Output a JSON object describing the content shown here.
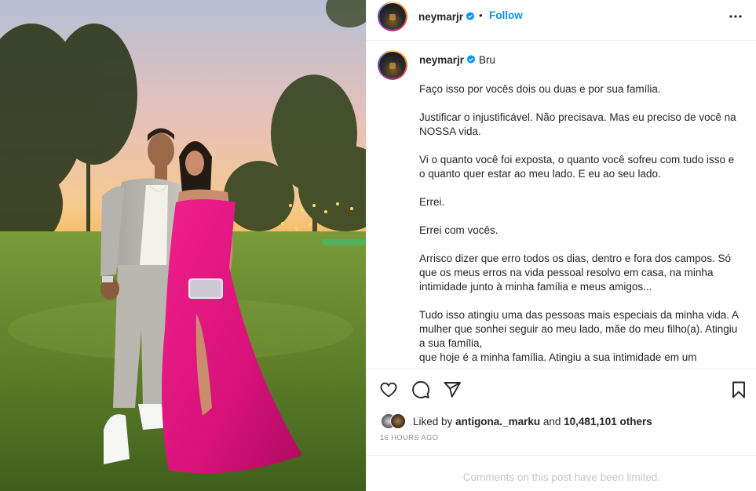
{
  "header": {
    "username": "neymarjr",
    "separator": "•",
    "follow_label": "Follow"
  },
  "caption": {
    "username": "neymarjr",
    "mention": "Bru",
    "paragraphs": [
      "Faço isso por vocês dois ou duas e por sua família.",
      "Justificar o injustificável. Não precisava. Mas eu preciso de você na NOSSA vida.",
      "Vi o quanto você foi exposta, o quanto você sofreu com tudo isso e o quanto quer estar ao meu lado. E eu ao seu lado.",
      "Errei.",
      "Errei com vocês.",
      "Arrisco dizer que erro todos os dias, dentro e fora dos campos. Só que os meus erros na vida pessoal resolvo em casa, na minha intimidade junto à minha família e meus amigos...",
      "Tudo isso atingiu uma das pessoas mais especiais da minha vida. A mulher que sonhei seguir ao meu lado, mãe do meu filho(a). Atingiu a sua família,\nque hoje é a minha família. Atingiu a sua intimidade em um"
    ]
  },
  "likes": {
    "prefix": "Liked by",
    "user": "antigona._marku",
    "conj": "and",
    "count": "10,481,101 others"
  },
  "timestamp": "16 HOURS AGO",
  "comments_limited": "Comments on this post have been limited.",
  "icons": {
    "like": "heart-icon",
    "comment": "comment-icon",
    "share": "paper-plane-icon",
    "save": "bookmark-icon",
    "more": "more-options-icon",
    "verified": "verified-badge-icon"
  },
  "colors": {
    "accent": "#0095f6",
    "verified": "#0095f6",
    "muted": "#8e8e8e",
    "border": "#efefef",
    "dress": "#e0177f"
  }
}
